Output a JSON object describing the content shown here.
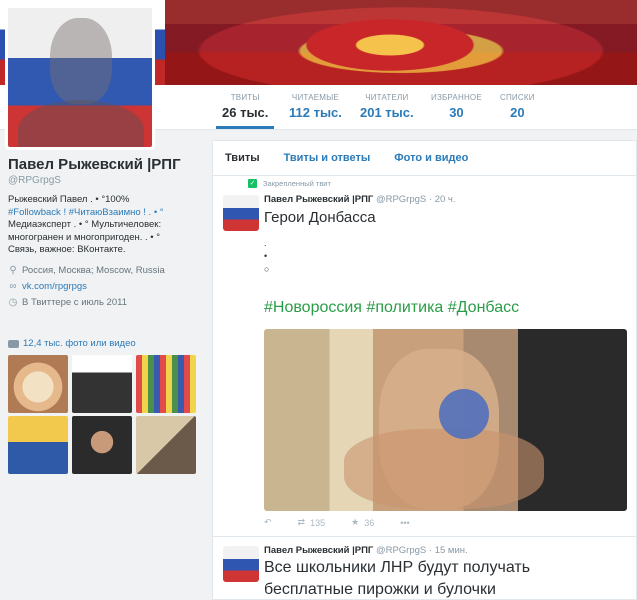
{
  "profile": {
    "name": "Павел Рыжевский |РПГ",
    "handle": "@RPGrpgS",
    "bio_line1": "Рыжевский Павел . • °100%",
    "bio_line2": "#Followback ! #ЧитаюВзаимно ! . • °",
    "bio_line3": "Медиаэксперт . • ° Мультичеловек:",
    "bio_line4": "многогранен и многопригоден. . • °",
    "bio_line5": "Связь, важное: ВКонтакте.",
    "location": "Россия, Москва; Moscow, Russia",
    "url": "vk.com/rpgrpgs",
    "joined": "В Твиттере с июль 2011",
    "photos_label": "12,4 тыс. фото или видео"
  },
  "stats": [
    {
      "label": "ТВИТЫ",
      "value": "26 тыс."
    },
    {
      "label": "ЧИТАЕМЫЕ",
      "value": "112 тыс."
    },
    {
      "label": "ЧИТАТЕЛИ",
      "value": "201 тыс."
    },
    {
      "label": "ИЗБРАННОЕ",
      "value": "30"
    },
    {
      "label": "СПИСКИ",
      "value": "20"
    }
  ],
  "tabs": [
    "Твиты",
    "Твиты и ответы",
    "Фото и видео"
  ],
  "tweet1": {
    "pinned": "Закрепленный твит",
    "name": "Павел Рыжевский |РПГ",
    "handle": "@RPGrpgS",
    "time": "20 ч.",
    "text": "Герои Донбасса",
    "bullet1": ".",
    "bullet2": "•",
    "bullet3": "○",
    "hashtags": "#Новороссия #политика #Донбасс",
    "retweets": "135",
    "favorites": "36"
  },
  "tweet2": {
    "name": "Павел Рыжевский |РПГ",
    "handle": "@RPGrpgS",
    "time": "15 мин.",
    "text_line1": "Все школьники ЛНР будут получать",
    "text_line2": "бесплатные пирожки и булочки"
  },
  "colors": {
    "accent": "#2b7bb9",
    "hashtag": "#2a9d47",
    "pin": "#17bf63"
  },
  "icons": {
    "location": "map-pin-icon",
    "link": "link-icon",
    "joined": "calendar-icon",
    "photos": "camera-icon",
    "reply": "reply-icon",
    "retweet": "retweet-icon",
    "favorite": "star-icon",
    "more": "more-icon",
    "pinned": "pin-icon"
  }
}
